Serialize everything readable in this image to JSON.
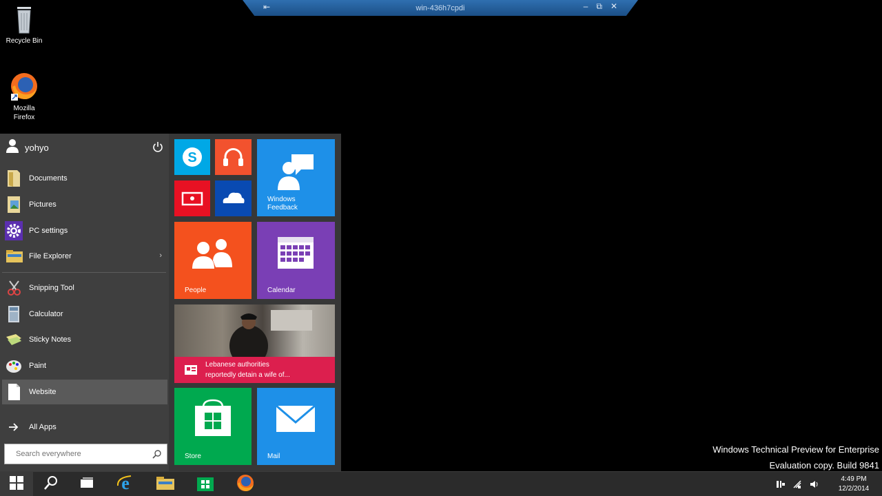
{
  "rdp": {
    "title": "win-436h7cpdi"
  },
  "desktop": {
    "icons": [
      {
        "label": "Recycle Bin"
      },
      {
        "label_line1": "Mozilla",
        "label_line2": "Firefox"
      }
    ]
  },
  "start_menu": {
    "user": "yohyo",
    "items": [
      {
        "label": "Documents"
      },
      {
        "label": "Pictures"
      },
      {
        "label": "PC settings"
      },
      {
        "label": "File Explorer"
      },
      {
        "label": "Snipping Tool"
      },
      {
        "label": "Calculator"
      },
      {
        "label": "Sticky Notes"
      },
      {
        "label": "Paint"
      },
      {
        "label": "Website"
      }
    ],
    "all_apps": "All Apps",
    "search_placeholder": "Search everywhere"
  },
  "tiles": {
    "windows_feedback": {
      "line1": "Windows",
      "line2": "Feedback"
    },
    "people": "People",
    "calendar": "Calendar",
    "news": {
      "line1": "Lebanese authorities",
      "line2": "reportedly detain a wife of..."
    },
    "store": "Store",
    "mail": "Mail"
  },
  "watermark": {
    "line1": "Windows Technical Preview for Enterprise",
    "line2": "Evaluation copy. Build 9841"
  },
  "taskbar": {
    "time": "4:49 PM",
    "date": "12/2/2014"
  },
  "colors": {
    "skype": "#00a8e6",
    "music": "#f2522e",
    "video": "#e81123",
    "onedrive": "#094ab2",
    "feedback": "#1e90e8",
    "people": "#f4511e",
    "calendar": "#7a3fb5",
    "news": "#dc1f4e",
    "store": "#00a94f",
    "mail": "#1e90e8"
  }
}
